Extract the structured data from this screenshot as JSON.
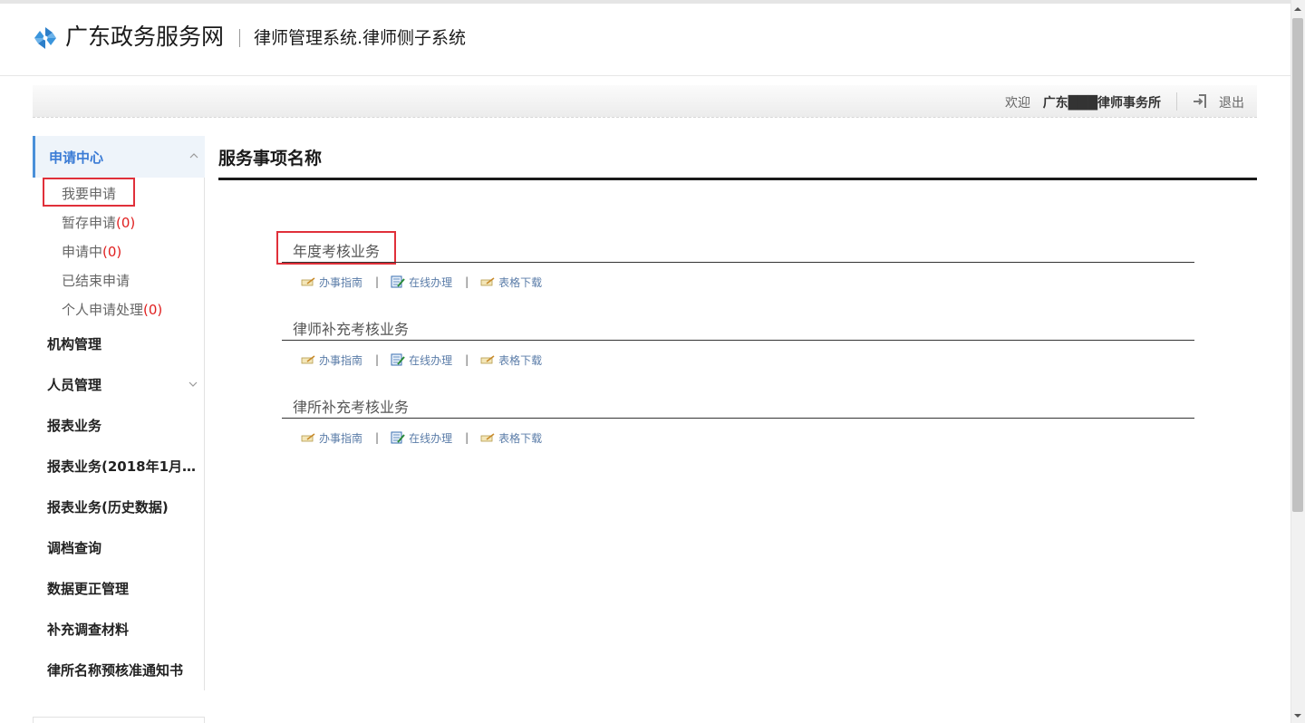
{
  "header": {
    "brand": "广东政务服务网",
    "system_title": "律师管理系统.律师侧子系统"
  },
  "userbar": {
    "welcome": "欢迎",
    "username": "广东███律师事务所",
    "logout": "退出"
  },
  "sidebar": {
    "section": "申请中心",
    "sub_items": [
      {
        "label": "我要申请",
        "count": ""
      },
      {
        "label": "暂存申请",
        "count": "(0)"
      },
      {
        "label": "申请中",
        "count": "(0)"
      },
      {
        "label": "已结束申请",
        "count": ""
      },
      {
        "label": "个人申请处理",
        "count": "(0)"
      }
    ],
    "items": [
      "机构管理",
      "人员管理",
      "报表业务",
      "报表业务(2018年1月至...",
      "报表业务(历史数据)",
      "调档查询",
      "数据更正管理",
      "补充调查材料",
      "律所名称预核准通知书"
    ]
  },
  "content": {
    "title": "服务事项名称",
    "services": [
      {
        "name": "年度考核业务",
        "guide": "办事指南",
        "online": "在线办理",
        "download": "表格下载"
      },
      {
        "name": "律师补充考核业务",
        "guide": "办事指南",
        "online": "在线办理",
        "download": "表格下载"
      },
      {
        "name": "律所补充考核业务",
        "guide": "办事指南",
        "online": "在线办理",
        "download": "表格下载"
      }
    ],
    "separator": "|"
  },
  "colors": {
    "accent": "#3a7bd5",
    "highlight_box": "#e0303a",
    "count_red": "#e02020",
    "link": "#5a7ca8"
  }
}
